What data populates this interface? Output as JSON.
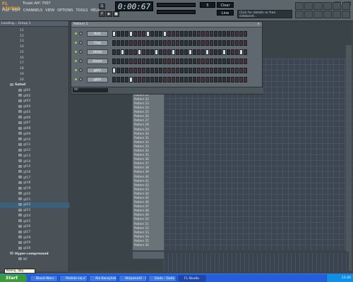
{
  "app": {
    "logo": "FL STUDIO",
    "song_title": "Truiaii AH! 7007",
    "hint": "",
    "time": "0:00:67",
    "numbox": "5",
    "tempo": "Clear",
    "linebox": "Line",
    "hintbox": "Click for details or free sideband..."
  },
  "menu": [
    "FILE",
    "EDIT",
    "CHANNELS",
    "VIEW",
    "OPTIONS",
    "TOOLS",
    "HELP"
  ],
  "browser": {
    "title": "Loading... Group 1",
    "items": [
      {
        "label": "11",
        "kind": "num"
      },
      {
        "label": "12",
        "kind": "num"
      },
      {
        "label": "13",
        "kind": "num"
      },
      {
        "label": "14",
        "kind": "num"
      },
      {
        "label": "15",
        "kind": "num"
      },
      {
        "label": "16",
        "kind": "num"
      },
      {
        "label": "17",
        "kind": "num"
      },
      {
        "label": "18",
        "kind": "num"
      },
      {
        "label": "19",
        "kind": "num"
      },
      {
        "label": "20",
        "kind": "num"
      },
      {
        "label": "Gated",
        "kind": "group"
      },
      {
        "label": "gt01",
        "kind": "f"
      },
      {
        "label": "gt02",
        "kind": "f"
      },
      {
        "label": "gt03",
        "kind": "f"
      },
      {
        "label": "gt04",
        "kind": "f"
      },
      {
        "label": "gt05",
        "kind": "f"
      },
      {
        "label": "gt06",
        "kind": "f"
      },
      {
        "label": "gt07",
        "kind": "f"
      },
      {
        "label": "gt08",
        "kind": "f"
      },
      {
        "label": "gt09",
        "kind": "f"
      },
      {
        "label": "gt10",
        "kind": "f"
      },
      {
        "label": "gt11",
        "kind": "f"
      },
      {
        "label": "gt12",
        "kind": "f"
      },
      {
        "label": "gt13",
        "kind": "f"
      },
      {
        "label": "gt14",
        "kind": "f"
      },
      {
        "label": "gt15",
        "kind": "f"
      },
      {
        "label": "gt16",
        "kind": "f"
      },
      {
        "label": "gt17",
        "kind": "f"
      },
      {
        "label": "gt18",
        "kind": "f"
      },
      {
        "label": "gt19",
        "kind": "f"
      },
      {
        "label": "gt20",
        "kind": "f"
      },
      {
        "label": "gt21",
        "kind": "f"
      },
      {
        "label": "gt22",
        "kind": "sel"
      },
      {
        "label": "gt23",
        "kind": "f"
      },
      {
        "label": "gt24",
        "kind": "f"
      },
      {
        "label": "gt25",
        "kind": "f"
      },
      {
        "label": "gt26",
        "kind": "f"
      },
      {
        "label": "gt27",
        "kind": "f"
      },
      {
        "label": "gt28",
        "kind": "f"
      },
      {
        "label": "gt29",
        "kind": "f"
      },
      {
        "label": "gt30",
        "kind": "f"
      },
      {
        "label": "Hyper-compressed",
        "kind": "group"
      },
      {
        "label": "NF",
        "kind": "f"
      }
    ]
  },
  "tooltip": "Kliknij, aby rozpocząć",
  "stepseq": {
    "title": "Pattern 1",
    "channels": [
      {
        "name": "Kick",
        "steps": [
          1,
          0,
          0,
          0,
          1,
          0,
          0,
          0,
          1,
          0,
          0,
          0,
          1,
          0,
          0,
          0,
          0,
          0,
          0,
          0,
          0,
          0,
          0,
          0,
          0,
          0,
          0,
          0,
          0,
          0,
          0,
          0
        ]
      },
      {
        "name": "Clap",
        "steps": [
          0,
          0,
          0,
          0,
          0,
          0,
          0,
          0,
          0,
          0,
          0,
          0,
          0,
          0,
          0,
          0,
          0,
          0,
          0,
          0,
          0,
          0,
          0,
          0,
          0,
          0,
          0,
          0,
          0,
          0,
          0,
          0
        ]
      },
      {
        "name": "HiHat",
        "steps": [
          0,
          0,
          1,
          0,
          0,
          0,
          1,
          0,
          0,
          0,
          1,
          0,
          0,
          0,
          1,
          0,
          0,
          0,
          1,
          0,
          0,
          0,
          1,
          0,
          0,
          0,
          1,
          0,
          0,
          0,
          1,
          0
        ]
      },
      {
        "name": "Snare",
        "steps": [
          0,
          0,
          0,
          0,
          0,
          0,
          0,
          0,
          0,
          0,
          0,
          0,
          0,
          0,
          0,
          0,
          0,
          0,
          0,
          0,
          0,
          0,
          0,
          0,
          0,
          0,
          0,
          0,
          0,
          0,
          0,
          0
        ]
      },
      {
        "name": "gt22",
        "steps": [
          1,
          0,
          0,
          0,
          0,
          0,
          0,
          0,
          0,
          0,
          0,
          0,
          0,
          0,
          0,
          0,
          0,
          0,
          0,
          0,
          0,
          0,
          0,
          0,
          0,
          0,
          0,
          0,
          0,
          0,
          0,
          0
        ]
      },
      {
        "name": "gt22",
        "steps": [
          0,
          0,
          0,
          0,
          1,
          0,
          0,
          0,
          0,
          0,
          0,
          0,
          0,
          0,
          0,
          0,
          0,
          0,
          0,
          0,
          0,
          0,
          0,
          0,
          0,
          0,
          0,
          0,
          0,
          0,
          0,
          0
        ]
      }
    ],
    "footer": "All"
  },
  "patterns": [
    "Pattern 13",
    "Pattern 14",
    "Pattern 15",
    "Pattern 16",
    "Pattern 17",
    "Pattern 18",
    "Pattern 19",
    "Pattern 20",
    "Pattern 21",
    "Pattern 22",
    "Pattern 23",
    "Pattern 24",
    "Pattern 25",
    "Pattern 26",
    "Pattern 27",
    "Pattern 28",
    "Pattern 29",
    "Pattern 30",
    "Pattern 31",
    "Pattern 32",
    "Pattern 33",
    "Pattern 34",
    "Pattern 35",
    "Pattern 36",
    "Pattern 37",
    "Pattern 38",
    "Pattern 39",
    "Pattern 40",
    "Pattern 41",
    "Pattern 42",
    "Pattern 43",
    "Pattern 44",
    "Pattern 45",
    "Pattern 46",
    "Pattern 47",
    "Pattern 48",
    "Pattern 49",
    "Pattern 50",
    "Pattern 51",
    "Pattern 52",
    "Pattern 53",
    "Pattern 54",
    "Pattern 55",
    "Pattern 56"
  ],
  "taskbar": {
    "start": "Start",
    "tasks": [
      "Blood Wars - Mozilla...",
      "Podziel się z Tobą ...",
      "Ala Kaczyński (Wik...",
      "Aktywność - Gadu...",
      "Gadu - Gadu czat...",
      "FL Studio"
    ],
    "clock": "11:40"
  }
}
